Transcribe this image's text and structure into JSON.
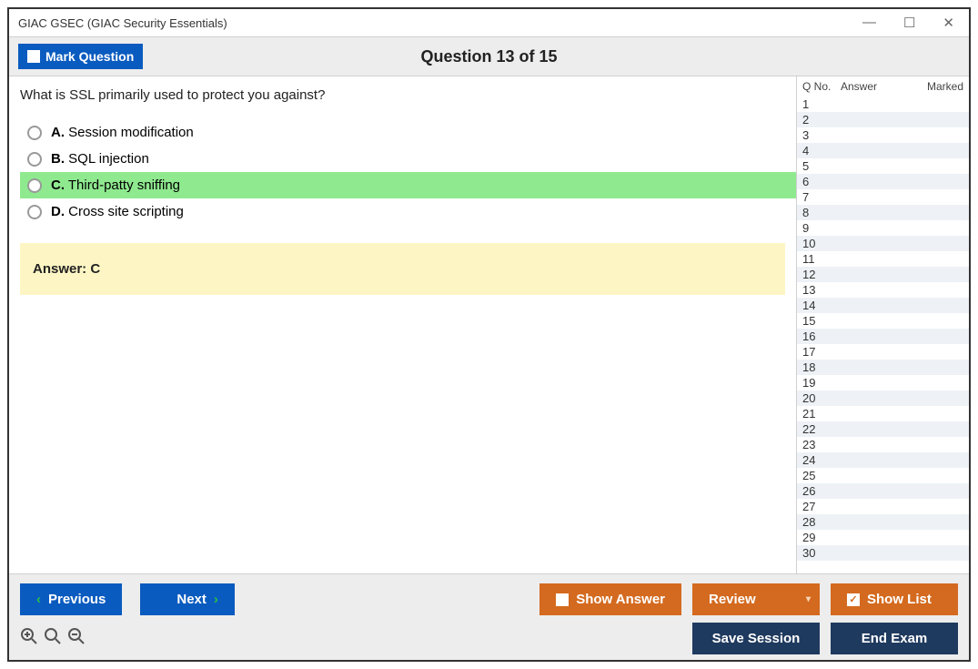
{
  "window": {
    "title": "GIAC GSEC (GIAC Security Essentials)"
  },
  "topbar": {
    "mark_label": "Mark Question",
    "question_title": "Question 13 of 15"
  },
  "question": {
    "text": "What is SSL primarily used to protect you against?",
    "options": [
      {
        "letter": "A.",
        "text": "Session modification"
      },
      {
        "letter": "B.",
        "text": "SQL injection"
      },
      {
        "letter": "C.",
        "text": "Third-patty sniffing"
      },
      {
        "letter": "D.",
        "text": "Cross site scripting"
      }
    ],
    "selected_index": 2,
    "answer_label": "Answer: C"
  },
  "sidebar": {
    "headers": {
      "qno": "Q No.",
      "answer": "Answer",
      "marked": "Marked"
    },
    "row_count": 30
  },
  "footer": {
    "previous": "Previous",
    "next": "Next",
    "show_answer": "Show Answer",
    "review": "Review",
    "show_list": "Show List",
    "save_session": "Save Session",
    "end_exam": "End Exam"
  }
}
